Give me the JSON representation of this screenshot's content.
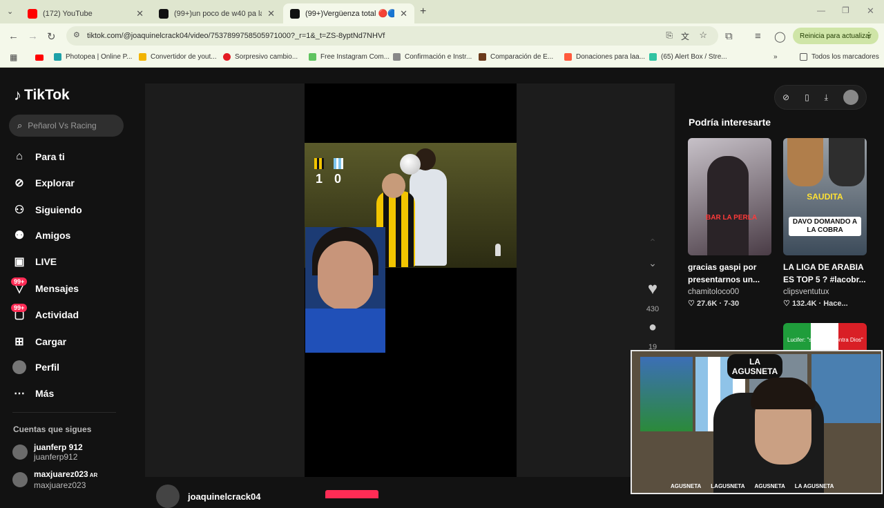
{
  "browser": {
    "tabs": [
      {
        "title": "(172) YouTube",
        "color": "#ff0000"
      },
      {
        "title": "(99+)un poco de w40 pa la silla",
        "color": "#111111"
      },
      {
        "title": "(99+)Vergüenza total 🔴🔵",
        "color": "#111111"
      }
    ],
    "url": "tiktok.com/@joaquinelcrack04/video/7537899758505971000?_r=1&_t=ZS-8yptNd7NHVf",
    "relaunch_label": "Reinicia para actualizar",
    "bookmarks": [
      "Photopea | Online P...",
      "Convertidor de yout...",
      "Sorpresivo cambio...",
      "Free Instagram Com...",
      "Confirmación e Instr...",
      "Comparación de E...",
      "Donaciones para laa...",
      "(65) Alert Box / Stre..."
    ],
    "all_bookmarks": "Todos los marcadores",
    "more_bookmarks": "»"
  },
  "sidebar": {
    "logo": "TikTok",
    "search_placeholder": "Peñarol Vs Racing",
    "items": [
      {
        "label": "Para ti",
        "icon": "home-icon"
      },
      {
        "label": "Explorar",
        "icon": "compass-icon"
      },
      {
        "label": "Siguiendo",
        "icon": "following-icon"
      },
      {
        "label": "Amigos",
        "icon": "friends-icon"
      },
      {
        "label": "LIVE",
        "icon": "live-icon"
      },
      {
        "label": "Mensajes",
        "icon": "inbox-icon",
        "badge": "99+"
      },
      {
        "label": "Actividad",
        "icon": "activity-icon",
        "badge": "99+"
      },
      {
        "label": "Cargar",
        "icon": "upload-icon"
      },
      {
        "label": "Perfil",
        "icon": "profile-icon"
      },
      {
        "label": "Más",
        "icon": "more-icon"
      }
    ],
    "following_heading": "Cuentas que sigues",
    "following": [
      {
        "name": "juanferp 912",
        "handle": "juanferp912"
      },
      {
        "name": "maxjuarez023",
        "suffix": "AR",
        "handle": "maxjuarez023"
      }
    ]
  },
  "video": {
    "scoreboard": {
      "home": "1",
      "away": "0"
    },
    "likes": "430",
    "comments": "19",
    "author_handle": "joaquinelcrack04"
  },
  "recommendations": {
    "title": "Podría interesarte",
    "items": [
      {
        "caption": "gracias gaspi por presentarnos un...",
        "author": "chamitoloco00",
        "likes": "27.6K",
        "date": "7-30",
        "overlay": "BAR LA PERLA"
      },
      {
        "caption": "LA LIGA DE ARABIA ES TOP 5 ? #lacobr...",
        "author": "clipsventutux",
        "likes": "132.4K",
        "date": "Hace...",
        "overlay1": "SAUDITA",
        "overlay2": "DAVO DOMANDO A LA COBRA"
      }
    ],
    "peek_caption": "Lucifer: \"se rebela contra Dios\""
  },
  "stream_overlay": {
    "logo_text": "LA AGUSNETA",
    "socials": [
      "AGUSNETA",
      "LAGUSNETA",
      "AGUSNETA",
      "LA AGUSNETA"
    ]
  }
}
